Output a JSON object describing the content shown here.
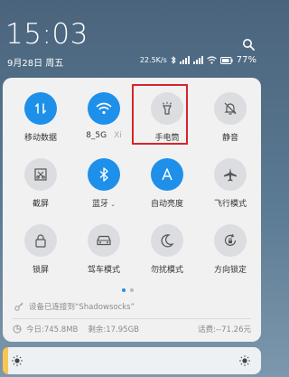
{
  "status": {
    "time": "15:03",
    "date": "9月28日 周五",
    "speed": "22.5K/s",
    "battery": "77%"
  },
  "tiles": [
    {
      "label": "移动数据",
      "icon": "mobile-data-icon",
      "state": "on"
    },
    {
      "label": "8_5G",
      "icon": "wifi-icon",
      "state": "on",
      "peek": "Xi"
    },
    {
      "label": "手电筒",
      "icon": "flashlight-icon",
      "state": "off"
    },
    {
      "label": "静音",
      "icon": "mute-icon",
      "state": "off"
    },
    {
      "label": "截屏",
      "icon": "screenshot-icon",
      "state": "off"
    },
    {
      "label": "蓝牙",
      "icon": "bluetooth-icon",
      "state": "on"
    },
    {
      "label": "自动亮度",
      "icon": "auto-brightness-icon",
      "state": "on"
    },
    {
      "label": "飞行模式",
      "icon": "airplane-icon",
      "state": "off"
    },
    {
      "label": "锁屏",
      "icon": "lock-icon",
      "state": "off"
    },
    {
      "label": "驾车模式",
      "icon": "car-icon",
      "state": "off"
    },
    {
      "label": "勿扰模式",
      "icon": "moon-icon",
      "state": "off"
    },
    {
      "label": "方向锁定",
      "icon": "rotation-lock-icon",
      "state": "off"
    }
  ],
  "page_indicator": {
    "current": 1,
    "total": 2
  },
  "device_connection": "设备已连接到“Shadowsocks”",
  "storage": {
    "today": "今日:745.8MB",
    "remaining": "剩余:17.95GB",
    "balance": "话费:--71.26元"
  },
  "colors": {
    "accent": "#1e90ea",
    "highlight": "#d8232a",
    "brightness": "#f7c653"
  }
}
